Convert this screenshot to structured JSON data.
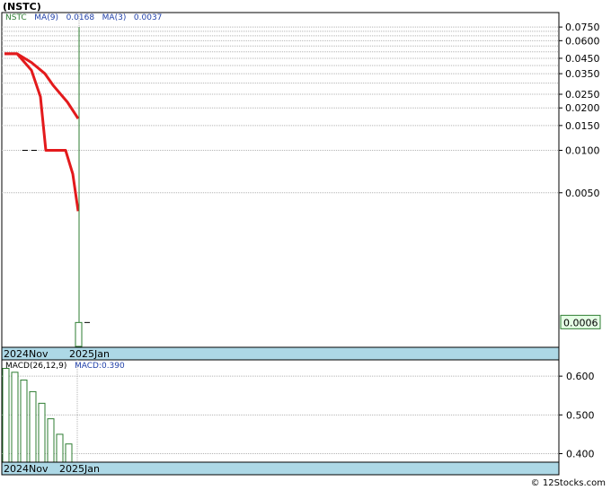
{
  "title": "(NSTC)",
  "credit": "© 12Stocks.com",
  "colors": {
    "ma9": "#e31a1c",
    "ma3": "#e31a1c",
    "price": "#2e7d32",
    "macd_bar": "#2e7d32",
    "date_strip": "#add8e6",
    "grid": "#b4b4b4",
    "last_price_box": "#e6ffe6"
  },
  "legend": {
    "symbol": "NSTC",
    "ma9_label": "MA(9)",
    "ma9_value": "0.0168",
    "ma3_label": "MA(3)",
    "ma3_value": "0.0037"
  },
  "macd_legend": {
    "label": "MACD(26,12,9)",
    "value_label": "MACD:0.390"
  },
  "chart_data": [
    {
      "type": "line",
      "title": "(NSTC)",
      "scale": "log",
      "ylim": [
        0.0004,
        0.095
      ],
      "y_ticks": [
        "0.0750",
        "0.0600",
        "0.0450",
        "0.0350",
        "0.0250",
        "0.0200",
        "0.0150",
        "0.0100",
        "0.0050"
      ],
      "x_labels": [
        "2024Nov",
        "2025Jan"
      ],
      "last_price_label": "0.0006",
      "x_range": [
        0,
        73
      ],
      "x_label_pos": [
        2,
        75
      ],
      "minor_grid": [
        0.07,
        0.065,
        0.055,
        0.05,
        0.04,
        0.03
      ],
      "series": [
        {
          "name": "MA(9)",
          "x": [
            3,
            17,
            33,
            48,
            57,
            73,
            85
          ],
          "values": [
            0.0485,
            0.0485,
            0.042,
            0.035,
            0.029,
            0.022,
            0.0168
          ]
        },
        {
          "name": "MA(3)",
          "x": [
            3,
            17,
            33,
            43,
            49,
            61,
            71,
            79,
            85
          ],
          "values": [
            0.0485,
            0.0485,
            0.037,
            0.024,
            0.01,
            0.01,
            0.01,
            0.0068,
            0.0037
          ]
        }
      ],
      "candles": [
        {
          "x": 73,
          "high": 0.075,
          "low": 0.0004,
          "open": 0.0004,
          "close": 0.0006,
          "right_tick": 0.0006
        }
      ],
      "stray_ticks": [
        {
          "x": 31,
          "value": 0.01
        }
      ]
    },
    {
      "type": "bar",
      "title": "MACD(26,12,9)",
      "ylim": [
        0.378,
        0.642
      ],
      "y_ticks": [
        "0.600",
        "0.500",
        "0.400"
      ],
      "x_labels": [
        "2024Nov",
        "2025Jan"
      ],
      "x": [
        5,
        15,
        25,
        35,
        45,
        55,
        65,
        75
      ],
      "values": [
        0.62,
        0.61,
        0.59,
        0.56,
        0.53,
        0.49,
        0.45,
        0.425
      ],
      "x_range": [
        0,
        73
      ],
      "x_label_pos": [
        2,
        64
      ]
    }
  ]
}
